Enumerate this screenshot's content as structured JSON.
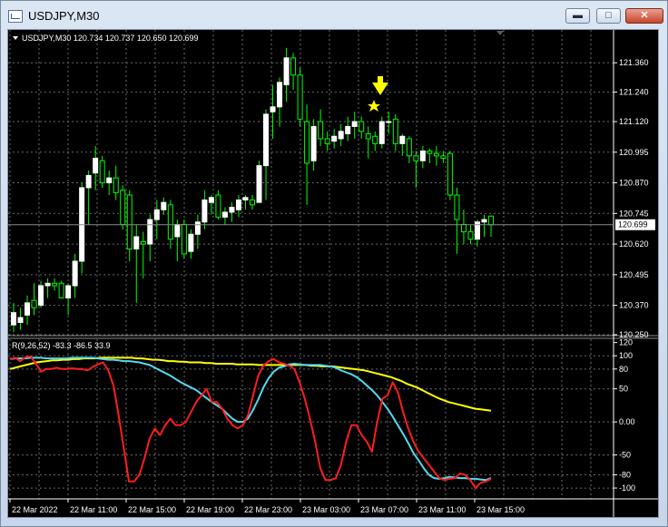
{
  "window": {
    "title": "USDJPY,M30",
    "minimize_label": "▬",
    "maximize_label": "□",
    "close_label": "✕"
  },
  "price_panel": {
    "header": "USDJPY,M30  120.734 120.737 120.650 120.699",
    "current_price": "120.699",
    "price_ticks": [
      "121.360",
      "121.240",
      "121.120",
      "120.995",
      "120.870",
      "120.745",
      "120.620",
      "120.495",
      "120.370",
      "120.250"
    ]
  },
  "indicator_panel": {
    "header": "R(9,26,52) -83.3 -86.5 33.9",
    "ticks": [
      "120",
      "100",
      "80",
      "50",
      "0.00",
      "-50",
      "-80",
      "-100"
    ]
  },
  "time_axis": [
    "22 Mar 2022",
    "22 Mar 11:00",
    "22 Mar 15:00",
    "22 Mar 19:00",
    "22 Mar 23:00",
    "23 Mar 03:00",
    "23 Mar 07:00",
    "23 Mar 11:00",
    "23 Mar 15:00"
  ],
  "colors": {
    "bull": "#ffffff",
    "bear": "#00ff00",
    "red_line": "#ff1e1e",
    "cyan_line": "#55d8f0",
    "yellow_line": "#ffff00",
    "grid": "#6b6b6b",
    "arrow": "#ffff00"
  },
  "icons": {
    "arrow": "down-arrow-icon",
    "star": "star-icon"
  },
  "chart_data": {
    "type": "candlestick",
    "symbol": "USDJPY",
    "timeframe": "M30",
    "ylim": [
      120.25,
      121.42
    ],
    "candles": [
      {
        "o": 120.29,
        "h": 120.38,
        "l": 120.26,
        "c": 120.34
      },
      {
        "o": 120.3,
        "h": 120.36,
        "l": 120.27,
        "c": 120.32
      },
      {
        "o": 120.33,
        "h": 120.41,
        "l": 120.29,
        "c": 120.38
      },
      {
        "o": 120.39,
        "h": 120.46,
        "l": 120.33,
        "c": 120.36
      },
      {
        "o": 120.37,
        "h": 120.47,
        "l": 120.36,
        "c": 120.45
      },
      {
        "o": 120.45,
        "h": 120.48,
        "l": 120.4,
        "c": 120.46
      },
      {
        "o": 120.46,
        "h": 120.48,
        "l": 120.43,
        "c": 120.45
      },
      {
        "o": 120.46,
        "h": 120.47,
        "l": 120.4,
        "c": 120.4
      },
      {
        "o": 120.4,
        "h": 120.46,
        "l": 120.33,
        "c": 120.45
      },
      {
        "o": 120.45,
        "h": 120.58,
        "l": 120.4,
        "c": 120.55
      },
      {
        "o": 120.55,
        "h": 120.87,
        "l": 120.5,
        "c": 120.85
      },
      {
        "o": 120.85,
        "h": 120.92,
        "l": 120.7,
        "c": 120.9
      },
      {
        "o": 120.91,
        "h": 121.02,
        "l": 120.84,
        "c": 120.97
      },
      {
        "o": 120.96,
        "h": 120.98,
        "l": 120.85,
        "c": 120.87
      },
      {
        "o": 120.87,
        "h": 120.92,
        "l": 120.82,
        "c": 120.89
      },
      {
        "o": 120.89,
        "h": 120.94,
        "l": 120.8,
        "c": 120.83
      },
      {
        "o": 120.84,
        "h": 120.86,
        "l": 120.68,
        "c": 120.7
      },
      {
        "o": 120.82,
        "h": 120.84,
        "l": 120.55,
        "c": 120.6
      },
      {
        "o": 120.6,
        "h": 120.7,
        "l": 120.38,
        "c": 120.65
      },
      {
        "o": 120.63,
        "h": 120.67,
        "l": 120.48,
        "c": 120.62
      },
      {
        "o": 120.62,
        "h": 120.74,
        "l": 120.55,
        "c": 120.72
      },
      {
        "o": 120.72,
        "h": 120.8,
        "l": 120.64,
        "c": 120.76
      },
      {
        "o": 120.76,
        "h": 120.81,
        "l": 120.74,
        "c": 120.79
      },
      {
        "o": 120.78,
        "h": 120.8,
        "l": 120.6,
        "c": 120.64
      },
      {
        "o": 120.65,
        "h": 120.72,
        "l": 120.55,
        "c": 120.7
      },
      {
        "o": 120.7,
        "h": 120.72,
        "l": 120.56,
        "c": 120.58
      },
      {
        "o": 120.59,
        "h": 120.68,
        "l": 120.56,
        "c": 120.66
      },
      {
        "o": 120.66,
        "h": 120.74,
        "l": 120.6,
        "c": 120.71
      },
      {
        "o": 120.71,
        "h": 120.84,
        "l": 120.68,
        "c": 120.8
      },
      {
        "o": 120.79,
        "h": 120.82,
        "l": 120.74,
        "c": 120.81
      },
      {
        "o": 120.82,
        "h": 120.84,
        "l": 120.72,
        "c": 120.73
      },
      {
        "o": 120.73,
        "h": 120.77,
        "l": 120.7,
        "c": 120.75
      },
      {
        "o": 120.75,
        "h": 120.79,
        "l": 120.71,
        "c": 120.77
      },
      {
        "o": 120.76,
        "h": 120.82,
        "l": 120.73,
        "c": 120.8
      },
      {
        "o": 120.8,
        "h": 120.82,
        "l": 120.76,
        "c": 120.81
      },
      {
        "o": 120.8,
        "h": 120.82,
        "l": 120.76,
        "c": 120.78
      },
      {
        "o": 120.79,
        "h": 120.96,
        "l": 120.79,
        "c": 120.94
      },
      {
        "o": 120.94,
        "h": 121.17,
        "l": 120.8,
        "c": 121.15
      },
      {
        "o": 121.16,
        "h": 121.27,
        "l": 121.05,
        "c": 121.18
      },
      {
        "o": 121.18,
        "h": 121.3,
        "l": 121.1,
        "c": 121.28
      },
      {
        "o": 121.27,
        "h": 121.42,
        "l": 121.2,
        "c": 121.38
      },
      {
        "o": 121.38,
        "h": 121.4,
        "l": 121.25,
        "c": 121.31
      },
      {
        "o": 121.31,
        "h": 121.34,
        "l": 121.1,
        "c": 121.13
      },
      {
        "o": 121.12,
        "h": 121.19,
        "l": 120.78,
        "c": 120.95
      },
      {
        "o": 120.96,
        "h": 121.13,
        "l": 120.92,
        "c": 121.1
      },
      {
        "o": 121.12,
        "h": 121.17,
        "l": 121.02,
        "c": 121.05
      },
      {
        "o": 121.05,
        "h": 121.08,
        "l": 121.0,
        "c": 121.03
      },
      {
        "o": 121.04,
        "h": 121.09,
        "l": 121.01,
        "c": 121.06
      },
      {
        "o": 121.05,
        "h": 121.11,
        "l": 121.02,
        "c": 121.08
      },
      {
        "o": 121.07,
        "h": 121.14,
        "l": 121.04,
        "c": 121.1
      },
      {
        "o": 121.1,
        "h": 121.16,
        "l": 121.05,
        "c": 121.12
      },
      {
        "o": 121.12,
        "h": 121.14,
        "l": 121.05,
        "c": 121.08
      },
      {
        "o": 121.07,
        "h": 121.1,
        "l": 120.97,
        "c": 121.05
      },
      {
        "o": 121.06,
        "h": 121.08,
        "l": 121.0,
        "c": 121.03
      },
      {
        "o": 121.03,
        "h": 121.14,
        "l": 121.01,
        "c": 121.12
      },
      {
        "o": 121.12,
        "h": 121.16,
        "l": 121.07,
        "c": 121.12
      },
      {
        "o": 121.13,
        "h": 121.15,
        "l": 121.0,
        "c": 121.03
      },
      {
        "o": 121.03,
        "h": 121.07,
        "l": 120.98,
        "c": 121.06
      },
      {
        "o": 121.05,
        "h": 121.06,
        "l": 120.95,
        "c": 120.98
      },
      {
        "o": 120.98,
        "h": 121.0,
        "l": 120.85,
        "c": 120.96
      },
      {
        "o": 120.96,
        "h": 121.02,
        "l": 120.93,
        "c": 121.0
      },
      {
        "o": 121.0,
        "h": 121.01,
        "l": 120.95,
        "c": 120.99
      },
      {
        "o": 120.99,
        "h": 121.02,
        "l": 120.94,
        "c": 120.98
      },
      {
        "o": 120.98,
        "h": 121.0,
        "l": 120.95,
        "c": 120.97
      },
      {
        "o": 120.99,
        "h": 121.0,
        "l": 120.8,
        "c": 120.82
      },
      {
        "o": 120.82,
        "h": 120.85,
        "l": 120.58,
        "c": 120.72
      },
      {
        "o": 120.7,
        "h": 120.76,
        "l": 120.62,
        "c": 120.67
      },
      {
        "o": 120.67,
        "h": 120.7,
        "l": 120.62,
        "c": 120.64
      },
      {
        "o": 120.64,
        "h": 120.72,
        "l": 120.61,
        "c": 120.71
      },
      {
        "o": 120.71,
        "h": 120.74,
        "l": 120.65,
        "c": 120.72
      },
      {
        "o": 120.734,
        "h": 120.737,
        "l": 120.65,
        "c": 120.699
      }
    ],
    "indicator": {
      "name": "R(9,26,52)",
      "ylim": [
        -115,
        125
      ],
      "levels": [
        100,
        80,
        50,
        0,
        -50,
        -80,
        -100
      ],
      "series": [
        {
          "color": "red",
          "values": [
            95,
            97,
            92,
            98,
            99,
            88,
            76,
            80,
            80,
            82,
            80,
            80,
            81,
            80,
            80,
            78,
            83,
            87,
            90,
            78,
            55,
            10,
            -40,
            -90,
            -90,
            -80,
            -55,
            -25,
            -10,
            -20,
            -5,
            5,
            -5,
            -5,
            0,
            15,
            30,
            40,
            50,
            30,
            30,
            20,
            5,
            -5,
            -10,
            -5,
            10,
            40,
            70,
            85,
            92,
            95,
            90,
            88,
            85,
            80,
            60,
            35,
            5,
            -30,
            -70,
            -88,
            -88,
            -85,
            -65,
            -30,
            -5,
            -5,
            -20,
            -30,
            -45,
            0,
            35,
            40,
            60,
            45,
            15,
            -10,
            -30,
            -45,
            -55,
            -65,
            -75,
            -85,
            -88,
            -86,
            -85,
            -78,
            -80,
            -88,
            -100,
            -92,
            -90,
            -86
          ]
        },
        {
          "color": "cyan",
          "values": [
            95,
            96,
            96,
            96,
            97,
            97,
            97,
            96,
            96,
            96,
            96,
            96,
            97,
            97,
            97,
            97,
            97,
            96,
            95,
            94,
            94,
            93,
            92,
            92,
            91,
            90,
            88,
            86,
            82,
            78,
            74,
            70,
            65,
            60,
            56,
            52,
            48,
            42,
            36,
            30,
            25,
            20,
            12,
            5,
            0,
            0,
            5,
            18,
            34,
            52,
            66,
            76,
            82,
            84,
            87,
            88,
            87,
            86,
            86,
            86,
            86,
            85,
            84,
            82,
            78,
            75,
            72,
            68,
            62,
            55,
            48,
            40,
            30,
            20,
            8,
            -5,
            -18,
            -32,
            -47,
            -58,
            -70,
            -80,
            -85,
            -86,
            -85,
            -83,
            -84,
            -85,
            -85,
            -86,
            -86,
            -87,
            -88,
            -85
          ]
        },
        {
          "color": "yellow",
          "values": [
            80,
            82,
            84,
            86,
            88,
            90,
            91,
            92,
            93,
            93,
            94,
            94,
            95,
            95,
            96,
            96,
            96,
            97,
            97,
            97,
            97,
            97,
            97,
            97,
            96,
            96,
            95,
            94,
            94,
            93,
            92,
            92,
            91,
            91,
            90,
            90,
            90,
            89,
            89,
            88,
            88,
            88,
            88,
            87,
            87,
            87,
            87,
            86,
            86,
            86,
            86,
            86,
            86,
            86,
            86,
            86,
            86,
            85,
            85,
            84,
            84,
            84,
            83,
            82,
            81,
            80,
            79,
            78,
            76,
            74,
            72,
            70,
            68,
            65,
            62,
            58,
            55,
            52,
            48,
            44,
            40,
            36,
            33,
            30,
            28,
            26,
            24,
            22,
            20,
            19,
            18,
            17
          ]
        }
      ]
    }
  }
}
